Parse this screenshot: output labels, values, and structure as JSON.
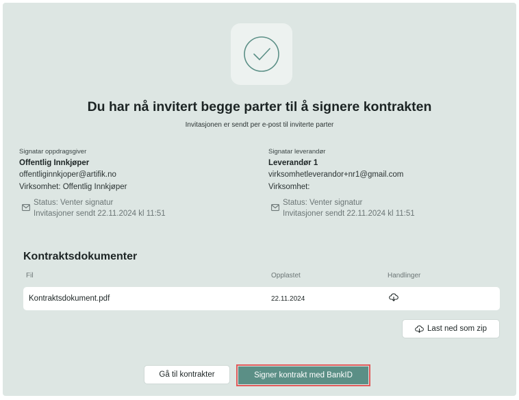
{
  "header": {
    "title": "Du har nå invitert begge parter til å signere kontrakten",
    "subtitle": "Invitasjonen er sendt per e-post til inviterte parter"
  },
  "parties": {
    "buyer": {
      "role": "Signatar oppdragsgiver",
      "name": "Offentlig Innkjøper",
      "email": "offentliginnkjoper@artifik.no",
      "company": "Virksomhet: Offentlig Innkjøper",
      "status": "Status: Venter signatur",
      "invited": "Invitasjoner sendt 22.11.2024 kl 11:51"
    },
    "supplier": {
      "role": "Signatar leverandør",
      "name": "Leverandør 1",
      "email": "virksomhetleverandor+nr1@gmail.com",
      "company": "Virksomhet:",
      "status": "Status: Venter signatur",
      "invited": "Invitasjoner sendt 22.11.2024 kl 11:51"
    }
  },
  "documents": {
    "section_title": "Kontraktsdokumenter",
    "columns": {
      "file": "Fil",
      "uploaded": "Opplastet",
      "actions": "Handlinger"
    },
    "rows": [
      {
        "file": "Kontraktsdokument.pdf",
        "uploaded": "22.11.2024",
        "action_icon": "cloud-download-icon"
      }
    ],
    "zip_button": "Last ned som zip"
  },
  "actions": {
    "back_label": "Gå til kontrakter",
    "sign_label": "Signer kontrakt med BankID"
  },
  "colors": {
    "card_bg": "#dde6e3",
    "primary": "#5b8f86",
    "highlight": "#e05a5a"
  }
}
